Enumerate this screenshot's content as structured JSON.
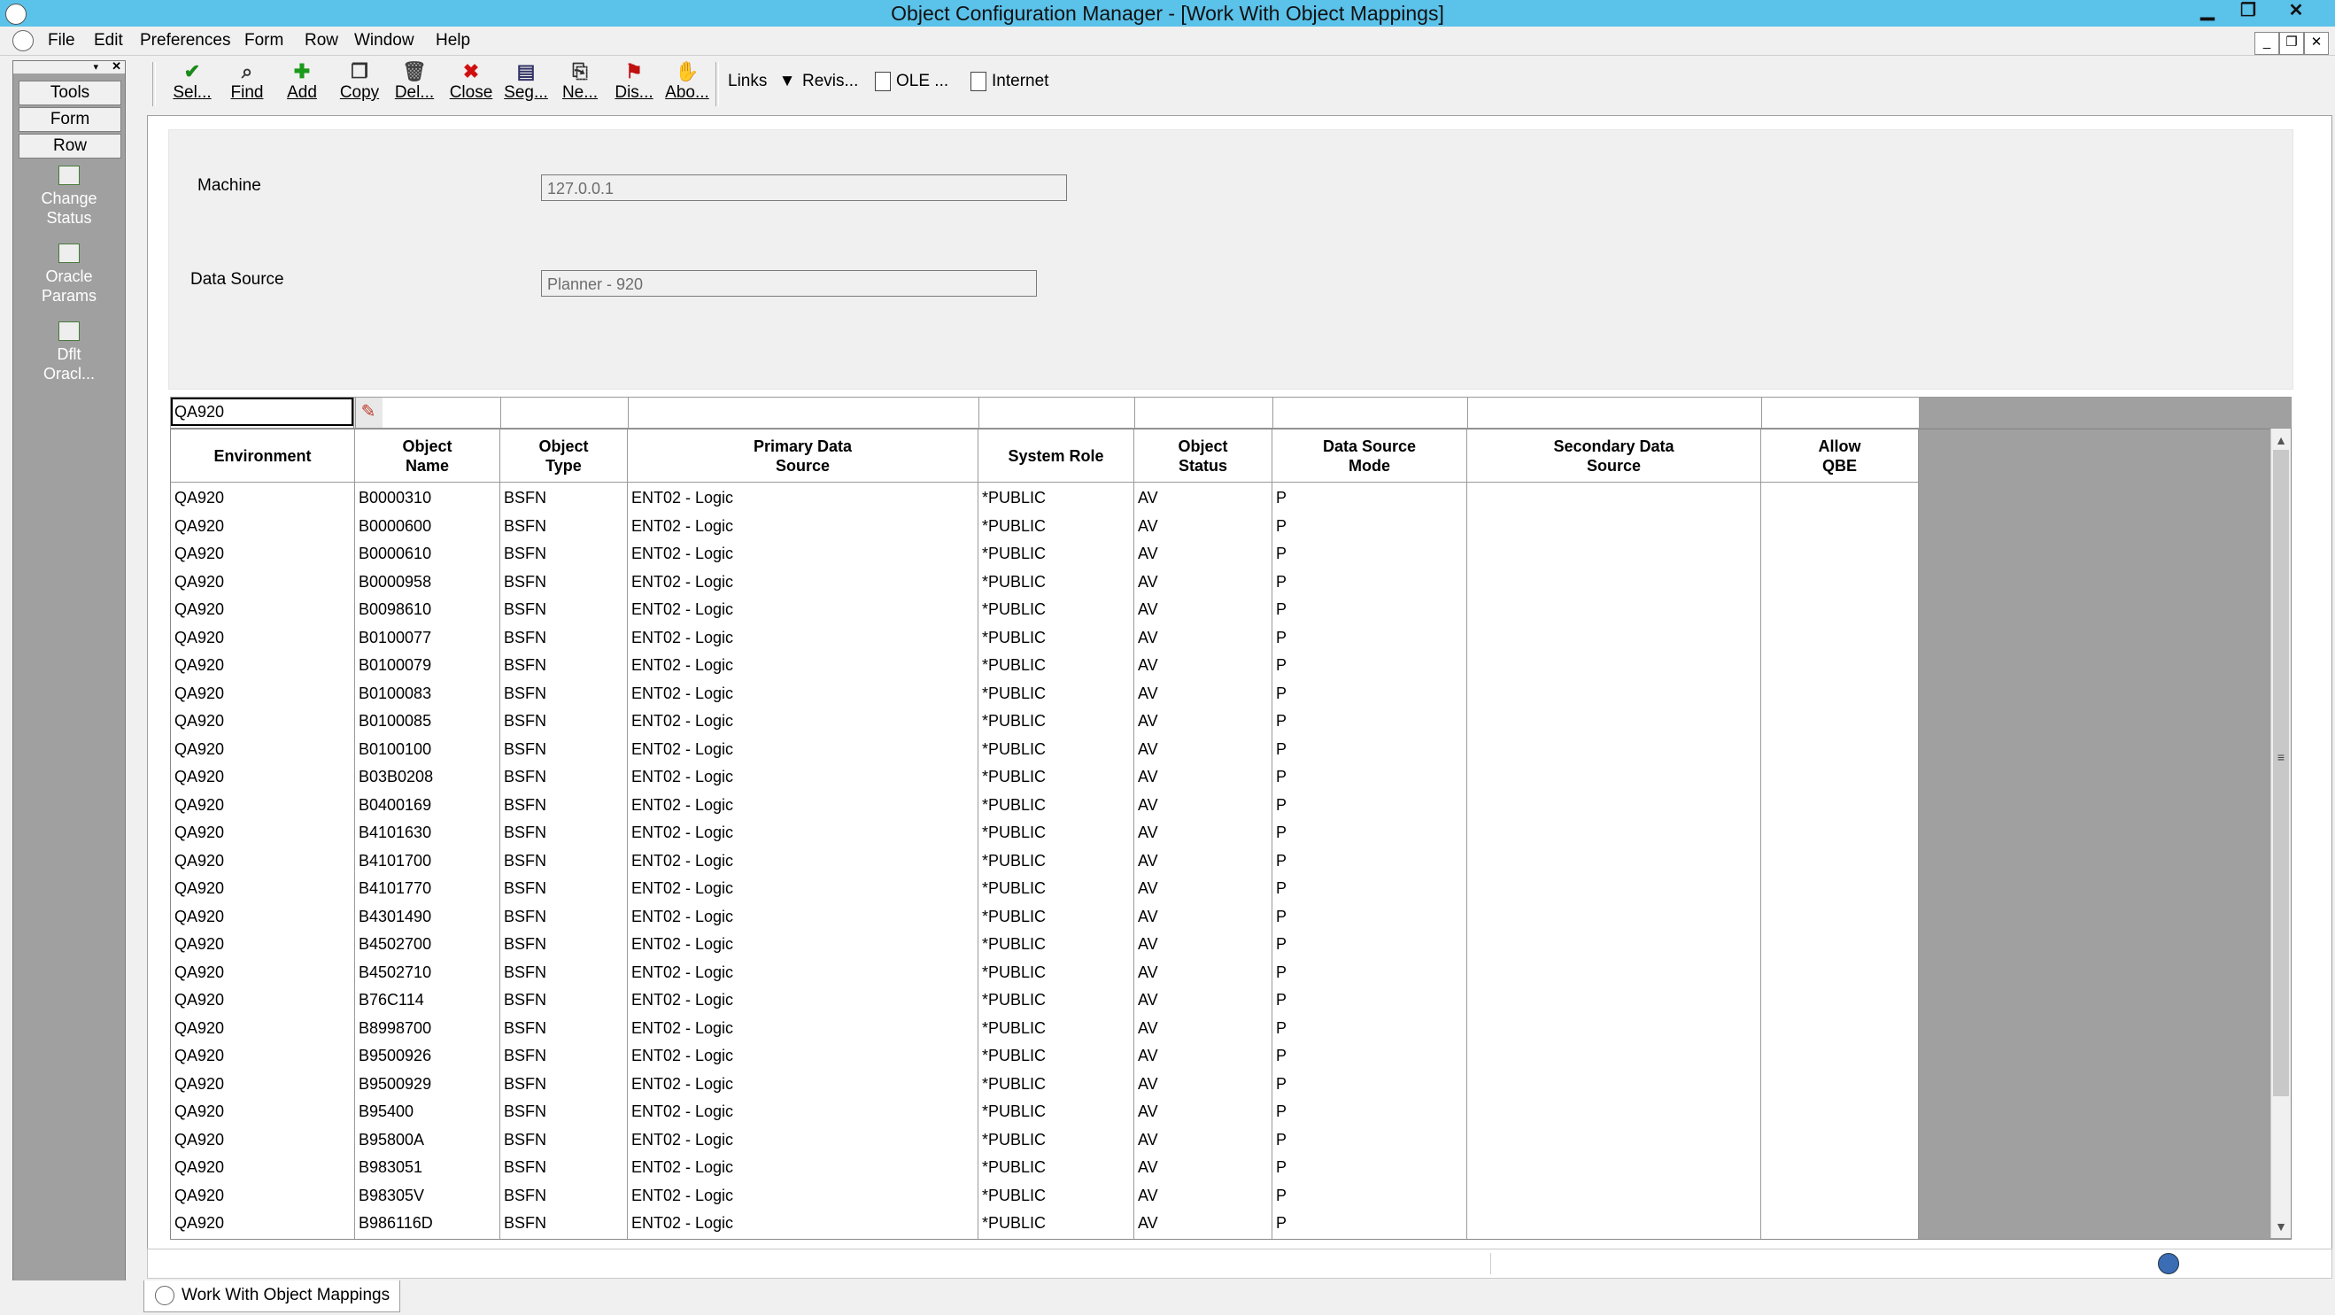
{
  "window": {
    "title": "Object Configuration Manager - [Work With Object Mappings]",
    "minimize": "▁",
    "restore": "❐",
    "close": "✕"
  },
  "menu": [
    "File",
    "Edit",
    "Preferences",
    "Form",
    "Row",
    "Window",
    "Help"
  ],
  "sidebar": {
    "tabs": [
      "Tools",
      "Form",
      "Row"
    ],
    "items": [
      {
        "label1": "Change",
        "label2": "Status"
      },
      {
        "label1": "Oracle",
        "label2": "Params"
      },
      {
        "label1": "Dflt",
        "label2": "Oracl..."
      }
    ]
  },
  "toolbar": {
    "buttons": [
      {
        "label": "Sel...",
        "icon": "✔",
        "color": "#1a8a1a"
      },
      {
        "label": "Find",
        "icon": "⌕",
        "color": "#333333"
      },
      {
        "label": "Add",
        "icon": "✚",
        "color": "#1a9a1a"
      },
      {
        "label": "Copy",
        "icon": "❐",
        "color": "#333333"
      },
      {
        "label": "Del...",
        "icon": "🗑",
        "color": "#444444"
      },
      {
        "label": "Close",
        "icon": "✖",
        "color": "#d01010"
      },
      {
        "label": "Seg...",
        "icon": "▤",
        "color": "#333366"
      },
      {
        "label": "Ne...",
        "icon": "⎘",
        "color": "#333333"
      },
      {
        "label": "Dis...",
        "icon": "⚑",
        "color": "#c01010"
      },
      {
        "label": "Abo...",
        "icon": "✋",
        "color": "#333333"
      }
    ],
    "links_label": "Links",
    "links_arrow": "▼",
    "revis_label": "Revis...",
    "ole_label": "OLE ...",
    "internet_label": "Internet"
  },
  "form": {
    "machine_label": "Machine",
    "machine_value": "127.0.0.1",
    "datasource_label": "Data Source",
    "datasource_value": "Planner - 920"
  },
  "qbe": {
    "environment_value": "QA920"
  },
  "grid": {
    "columns": [
      "Environment",
      "Object\nName",
      "Object\nType",
      "Primary Data\nSource",
      "System Role",
      "Object\nStatus",
      "Data Source\nMode",
      "Secondary Data\nSource",
      "Allow\nQBE"
    ],
    "rows": [
      [
        "QA920",
        "B0000310",
        "BSFN",
        "ENT02 - Logic",
        "*PUBLIC",
        "AV",
        "P",
        "",
        ""
      ],
      [
        "QA920",
        "B0000600",
        "BSFN",
        "ENT02 - Logic",
        "*PUBLIC",
        "AV",
        "P",
        "",
        ""
      ],
      [
        "QA920",
        "B0000610",
        "BSFN",
        "ENT02 - Logic",
        "*PUBLIC",
        "AV",
        "P",
        "",
        ""
      ],
      [
        "QA920",
        "B0000958",
        "BSFN",
        "ENT02 - Logic",
        "*PUBLIC",
        "AV",
        "P",
        "",
        ""
      ],
      [
        "QA920",
        "B0098610",
        "BSFN",
        "ENT02 - Logic",
        "*PUBLIC",
        "AV",
        "P",
        "",
        ""
      ],
      [
        "QA920",
        "B0100077",
        "BSFN",
        "ENT02 - Logic",
        "*PUBLIC",
        "AV",
        "P",
        "",
        ""
      ],
      [
        "QA920",
        "B0100079",
        "BSFN",
        "ENT02 - Logic",
        "*PUBLIC",
        "AV",
        "P",
        "",
        ""
      ],
      [
        "QA920",
        "B0100083",
        "BSFN",
        "ENT02 - Logic",
        "*PUBLIC",
        "AV",
        "P",
        "",
        ""
      ],
      [
        "QA920",
        "B0100085",
        "BSFN",
        "ENT02 - Logic",
        "*PUBLIC",
        "AV",
        "P",
        "",
        ""
      ],
      [
        "QA920",
        "B0100100",
        "BSFN",
        "ENT02 - Logic",
        "*PUBLIC",
        "AV",
        "P",
        "",
        ""
      ],
      [
        "QA920",
        "B03B0208",
        "BSFN",
        "ENT02 - Logic",
        "*PUBLIC",
        "AV",
        "P",
        "",
        ""
      ],
      [
        "QA920",
        "B0400169",
        "BSFN",
        "ENT02 - Logic",
        "*PUBLIC",
        "AV",
        "P",
        "",
        ""
      ],
      [
        "QA920",
        "B4101630",
        "BSFN",
        "ENT02 - Logic",
        "*PUBLIC",
        "AV",
        "P",
        "",
        ""
      ],
      [
        "QA920",
        "B4101700",
        "BSFN",
        "ENT02 - Logic",
        "*PUBLIC",
        "AV",
        "P",
        "",
        ""
      ],
      [
        "QA920",
        "B4101770",
        "BSFN",
        "ENT02 - Logic",
        "*PUBLIC",
        "AV",
        "P",
        "",
        ""
      ],
      [
        "QA920",
        "B4301490",
        "BSFN",
        "ENT02 - Logic",
        "*PUBLIC",
        "AV",
        "P",
        "",
        ""
      ],
      [
        "QA920",
        "B4502700",
        "BSFN",
        "ENT02 - Logic",
        "*PUBLIC",
        "AV",
        "P",
        "",
        ""
      ],
      [
        "QA920",
        "B4502710",
        "BSFN",
        "ENT02 - Logic",
        "*PUBLIC",
        "AV",
        "P",
        "",
        ""
      ],
      [
        "QA920",
        "B76C114",
        "BSFN",
        "ENT02 - Logic",
        "*PUBLIC",
        "AV",
        "P",
        "",
        ""
      ],
      [
        "QA920",
        "B8998700",
        "BSFN",
        "ENT02 - Logic",
        "*PUBLIC",
        "AV",
        "P",
        "",
        ""
      ],
      [
        "QA920",
        "B9500926",
        "BSFN",
        "ENT02 - Logic",
        "*PUBLIC",
        "AV",
        "P",
        "",
        ""
      ],
      [
        "QA920",
        "B9500929",
        "BSFN",
        "ENT02 - Logic",
        "*PUBLIC",
        "AV",
        "P",
        "",
        ""
      ],
      [
        "QA920",
        "B95400",
        "BSFN",
        "ENT02 - Logic",
        "*PUBLIC",
        "AV",
        "P",
        "",
        ""
      ],
      [
        "QA920",
        "B95800A",
        "BSFN",
        "ENT02 - Logic",
        "*PUBLIC",
        "AV",
        "P",
        "",
        ""
      ],
      [
        "QA920",
        "B983051",
        "BSFN",
        "ENT02 - Logic",
        "*PUBLIC",
        "AV",
        "P",
        "",
        ""
      ],
      [
        "QA920",
        "B98305V",
        "BSFN",
        "ENT02 - Logic",
        "*PUBLIC",
        "AV",
        "P",
        "",
        ""
      ],
      [
        "QA920",
        "B986116D",
        "BSFN",
        "ENT02 - Logic",
        "*PUBLIC",
        "AV",
        "P",
        "",
        ""
      ]
    ]
  },
  "scroll": {
    "up": "▲",
    "down": "▼",
    "grip": "≡"
  },
  "tabs": {
    "active": "Work With Object Mappings"
  }
}
